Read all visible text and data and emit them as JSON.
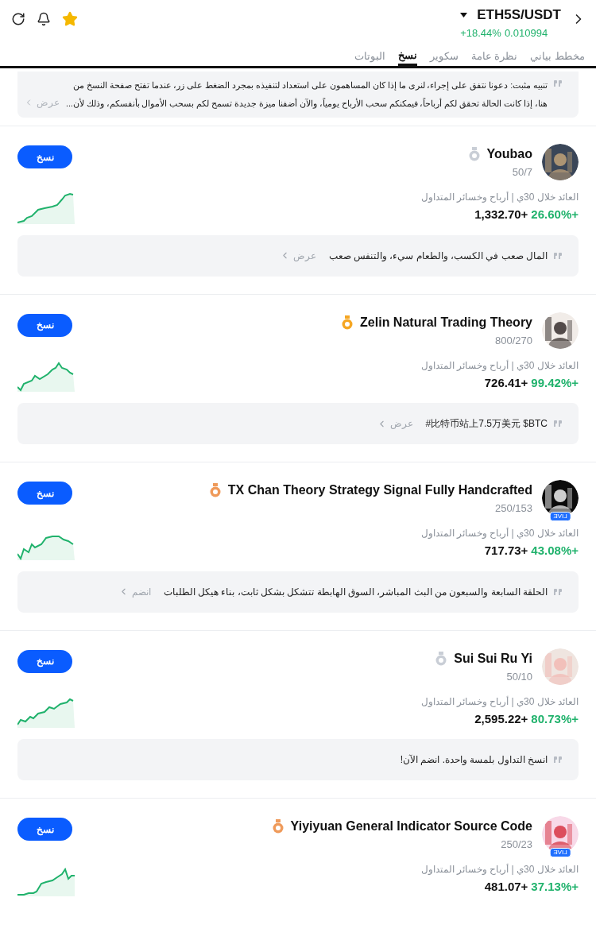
{
  "header": {
    "pair": "ETH5S/USDT",
    "change": "+18.44%",
    "price": "0.010994",
    "favorite": true
  },
  "tabs": [
    {
      "label": "مخطط بياني",
      "selected": false
    },
    {
      "label": "نظرة عامة",
      "selected": false
    },
    {
      "label": "سكوير",
      "selected": false
    },
    {
      "label": "نسخ",
      "selected": true
    },
    {
      "label": "البوتات",
      "selected": false
    }
  ],
  "notice": {
    "text": "تنبيه مثبت: دعونا نتفق على إجراء، لنرى ما إذا كان المساهمون على استعداد لتنفيذه بمجرد الضغط على زر، عندما تفتح صفحة النسخ من هنا، إذا كانت الحالة تحقق لكم أرباحاً، فيمكنكم سحب الأرباح يومياً، والآن أضفنا ميزة جديدة تسمح لكم بسحب الأموال بأنفسكم، وذلك لأن...",
    "link": "عرض"
  },
  "traders": [
    {
      "name": "Youbao",
      "medal": {
        "color": "#c9ced6"
      },
      "live": false,
      "count": "50/7",
      "stats_label": "العائد خلال 30ي | أرباح وخسائر المتداول",
      "roi": "+26.60%",
      "pnl": "+1,332.70",
      "button": "نسخ",
      "message": "المال صعب في الكسب، والطعام سيء، والتنفس صعب",
      "link": "عرض"
    },
    {
      "name": "Zelin Natural Trading Theory",
      "medal": {
        "color": "#f5a623"
      },
      "live": false,
      "count": "800/270",
      "stats_label": "العائد خلال 30ي | أرباح وخسائر المتداول",
      "roi": "+99.42%",
      "pnl": "+726.41",
      "button": "نسخ",
      "message": "比特币站上7.5万美元 $BTC#",
      "link": "عرض"
    },
    {
      "name": "TX Chan Theory Strategy Signal Fully Handcrafted",
      "medal": {
        "color": "#ef9a5a"
      },
      "live": true,
      "live_label": "LIVE",
      "count": "250/153",
      "stats_label": "العائد خلال 30ي | أرباح وخسائر المتداول",
      "roi": "+43.08%",
      "pnl": "+717.73",
      "button": "نسخ",
      "message": "الحلقة السابعة والسبعون من البث المباشر، السوق الهابطة تتشكل بشكل ثابت، بناء هيكل الطلبات",
      "link": "انضم"
    },
    {
      "name": "Sui Sui Ru Yi",
      "medal": {
        "color": "#c9ced6"
      },
      "live": false,
      "count": "50/10",
      "stats_label": "العائد خلال 30ي | أرباح وخسائر المتداول",
      "roi": "+80.73%",
      "pnl": "+2,595.22",
      "button": "نسخ",
      "message": "انسخ التداول بلمسة واحدة. انضم الآن!"
    },
    {
      "name": "Yiyiyuan General Indicator Source Code",
      "medal": {
        "color": "#ef9a5a"
      },
      "live": true,
      "live_label": "LIVE",
      "count": "250/23",
      "stats_label": "العائد خلال 30ي | أرباح وخسائر المتداول",
      "roi": "+37.13%",
      "pnl": "+481.07",
      "button": "نسخ"
    }
  ]
}
